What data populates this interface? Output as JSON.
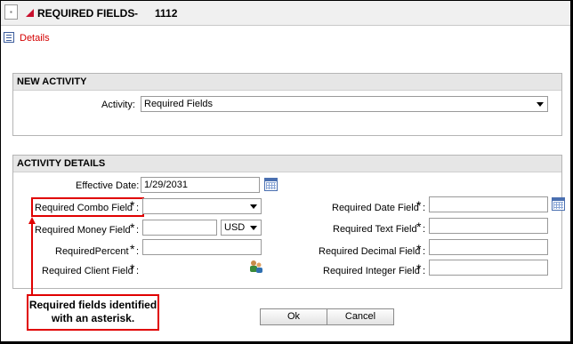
{
  "header": {
    "title": "REQUIRED FIELDS",
    "separator": "-",
    "record_number": "1112"
  },
  "details_link": "Details",
  "new_activity": {
    "heading": "NEW ACTIVITY",
    "activity_label": "Activity:",
    "activity_value": "Required Fields"
  },
  "activity_details": {
    "heading": "ACTIVITY DETAILS",
    "effective_date_label": "Effective Date:",
    "effective_date_value": "1/29/2031",
    "combo_label": "Required Combo Field",
    "money_label": "Required Money Field",
    "money_currency": "USD",
    "percent_label": "RequiredPercent",
    "client_label": "Required Client Field",
    "date_label": "Required Date Field",
    "text_label": "Required Text Field",
    "decimal_label": "Required Decimal Field",
    "integer_label": "Required Integer Field",
    "asterisk": "*",
    "colon": ":"
  },
  "callout": {
    "line1": "Required fields identified",
    "line2": "with an asterisk."
  },
  "buttons": {
    "ok": "Ok",
    "cancel": "Cancel"
  },
  "colors": {
    "accent_red": "#e00000",
    "link_red": "#d40000",
    "section_header": "#e6e6e6"
  },
  "icons": [
    "window-menu-icon",
    "title-triangle-icon",
    "details-list-icon",
    "calendar-icon",
    "client-lookup-icon",
    "dropdown-arrow-icon"
  ]
}
